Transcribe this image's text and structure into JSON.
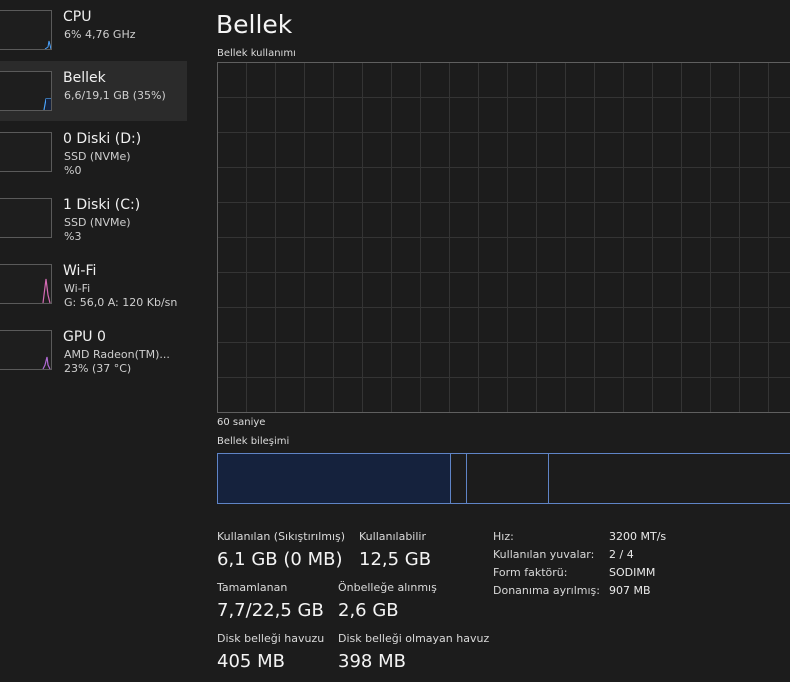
{
  "sidebar": {
    "items": [
      {
        "title": "CPU",
        "line1": "6% 4,76 GHz",
        "line2": "",
        "color": "#4aa3ff"
      },
      {
        "title": "Bellek",
        "line1": "6,6/19,1 GB (35%)",
        "line2": "",
        "color": "#4aa3ff"
      },
      {
        "title": "0 Diski (D:)",
        "line1": "SSD (NVMe)",
        "line2": "%0",
        "color": "#6cc24a"
      },
      {
        "title": "1 Diski (C:)",
        "line1": "SSD (NVMe)",
        "line2": "%3",
        "color": "#6cc24a"
      },
      {
        "title": "Wi-Fi",
        "line1": "Wi-Fi",
        "line2": "G: 56,0 A: 120 Kb/sn",
        "color": "#d46ab3"
      },
      {
        "title": "GPU 0",
        "line1": "AMD Radeon(TM)...",
        "line2": "23% (37 °C)",
        "color": "#b06ad4"
      }
    ]
  },
  "main": {
    "title": "Bellek",
    "usage_label": "Bellek kullanımı",
    "time_label": "60 saniye",
    "composition_label": "Bellek bileşimi"
  },
  "stats": {
    "in_use_label": "Kullanılan (Sıkıştırılmış)",
    "in_use_value": "6,1 GB (0 MB)",
    "available_label": "Kullanılabilir",
    "available_value": "12,5 GB",
    "committed_label": "Tamamlanan",
    "committed_value": "7,7/22,5 GB",
    "cached_label": "Önbelleğe alınmış",
    "cached_value": "2,6 GB",
    "paged_label": "Disk belleği havuzu",
    "paged_value": "405 MB",
    "nonpaged_label": "Disk belleği olmayan havuz",
    "nonpaged_value": "398 MB"
  },
  "specs": {
    "speed_label": "Hız:",
    "speed_value": "3200 MT/s",
    "slots_label": "Kullanılan yuvalar:",
    "slots_value": "2 / 4",
    "form_label": "Form faktörü:",
    "form_value": "SODIMM",
    "reserved_label": "Donanıma ayrılmış:",
    "reserved_value": "907 MB"
  },
  "colors": {
    "accent": "#5f84c6",
    "background": "#1c1c1c",
    "selected": "#2b2b2b"
  }
}
